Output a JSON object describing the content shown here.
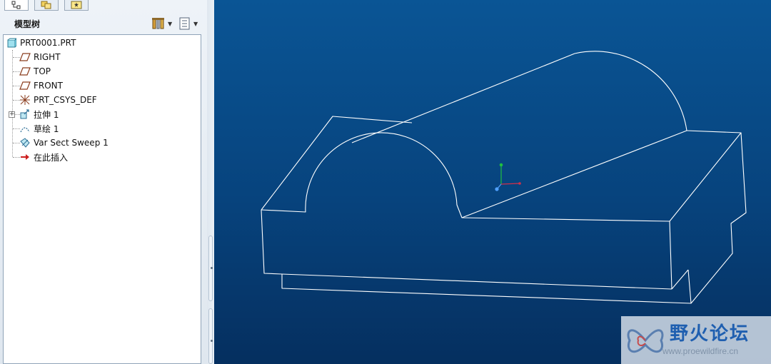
{
  "panel": {
    "title": "模型树"
  },
  "tree": {
    "items": [
      {
        "label": "PRT0001.PRT",
        "icon": "part-icon"
      },
      {
        "label": "RIGHT",
        "icon": "datum-plane-icon"
      },
      {
        "label": "TOP",
        "icon": "datum-plane-icon"
      },
      {
        "label": "FRONT",
        "icon": "datum-plane-icon"
      },
      {
        "label": "PRT_CSYS_DEF",
        "icon": "coordinate-system-icon"
      },
      {
        "label": "拉伸 1",
        "icon": "extrude-icon"
      },
      {
        "label": "草绘 1",
        "icon": "sketch-icon"
      },
      {
        "label": "Var Sect Sweep 1",
        "icon": "sweep-icon"
      },
      {
        "label": "在此插入",
        "icon": "insert-here-arrow-icon"
      }
    ]
  },
  "watermark": {
    "title": "野火论坛",
    "url": "www.proewildfire.cn"
  },
  "colors": {
    "viewport_top": "#0a5595",
    "viewport_bottom": "#052f5f",
    "wireframe": "#ffffff",
    "csys_x": "#d0304a",
    "csys_y": "#20c040",
    "csys_z": "#50a0ff"
  }
}
